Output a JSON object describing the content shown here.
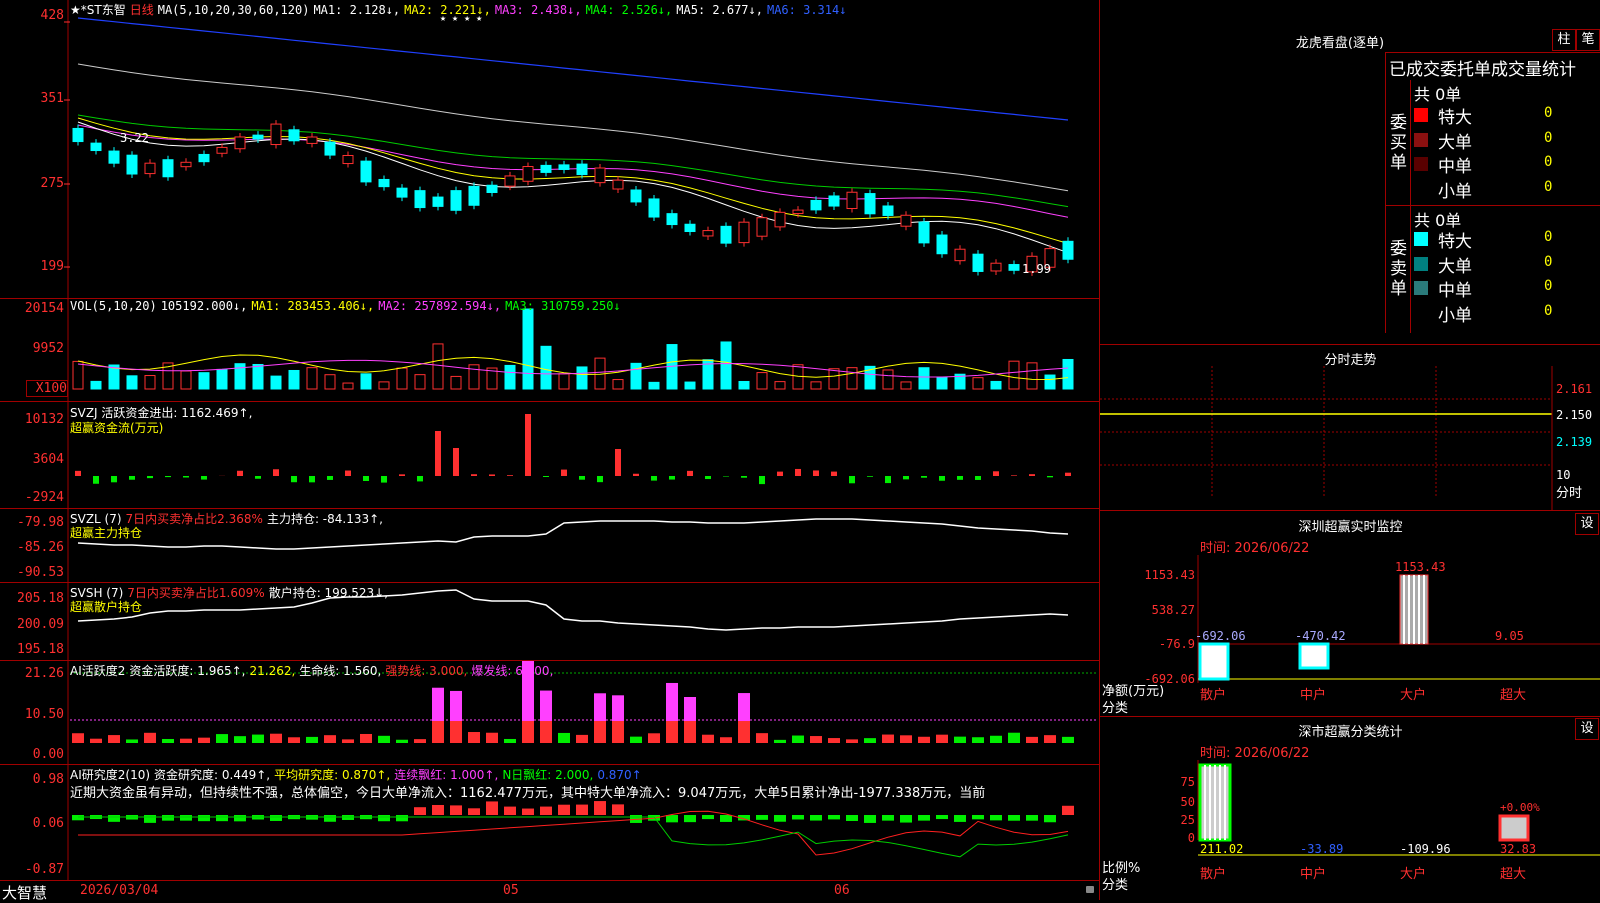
{
  "colors": {
    "up": "#ff3030",
    "down": "#00ffff",
    "bg": "#000000",
    "frame": "#a00000"
  },
  "kline": {
    "stock": "★*ST东智",
    "period": "日线",
    "ma_label": "MA(5,10,20,30,60,120)",
    "ma1": "MA1: 2.128↓,",
    "ma2": "MA2: 2.221↓,",
    "ma3": "MA3: 2.438↓,",
    "ma4": "MA4: 2.526↓,",
    "ma5": "MA5: 2.677↓,",
    "ma6": "MA6: 3.314↓",
    "y_labels": [
      "428",
      "351",
      "275",
      "199"
    ],
    "high_mark": "3.22",
    "low_mark": "1.99",
    "stars": "★ ★ ★ ★"
  },
  "vol": {
    "header": "VOL(5,10,20)",
    "value": "105192.000↓,",
    "ma1": "MA1: 283453.406↓,",
    "ma2": "MA2: 257892.594↓,",
    "ma3": "MA3: 310759.250↓",
    "y_labels": [
      "20154",
      "9952",
      "X100"
    ]
  },
  "svzj": {
    "header": "SVZJ  活跃资金进出: 1162.469↑,",
    "sub": "超赢资金流(万元)",
    "y_labels": [
      "10132",
      "3604",
      "-2924"
    ]
  },
  "svzl": {
    "header": "SVZL (7)",
    "red_text": "7日内买卖净占比2.368%",
    "tail": "主力持仓: -84.133↑,",
    "sub": "超赢主力持仓",
    "y_labels": [
      "-79.98",
      "-85.26",
      "-90.53"
    ]
  },
  "svsh": {
    "header": "SVSH (7)",
    "red_text": "7日内买卖净占比1.609%",
    "tail": "散户持仓: 199.523↓,",
    "sub": "超赢散户持仓",
    "y_labels": [
      "205.18",
      "200.09",
      "195.18"
    ]
  },
  "ai1": {
    "header": "AI活跃度2",
    "a": "资金活跃度: 1.965↑,",
    "b": "21.262,",
    "c": "生命线: 1.560,",
    "d": "强势线: 3.000,",
    "e": "爆发线: 6.000,",
    "y_labels": [
      "21.26",
      "10.50",
      "0.00"
    ]
  },
  "ai2": {
    "header": "AI研究度2(10)",
    "a": "资金研究度: 0.449↑,",
    "b": "平均研究度: 0.870↑,",
    "c": "连续飘红: 1.000↑,",
    "d": "N日飘红: 2.000,",
    "e": "0.870↑",
    "comment": "近期大资金虽有异动，但持续性不强，总体偏空，今日大单净流入：1162.477万元，其中特大单净流入：9.047万元，大单5日累计净出-1977.338万元，当前",
    "y_labels": [
      "0.98",
      "0.06",
      "-0.87"
    ]
  },
  "bottom": {
    "brand": "大智慧",
    "dates": [
      "2026/03/04",
      "05",
      "06"
    ]
  },
  "right": {
    "lhb_title": "龙虎看盘(逐单)",
    "btn_bar": "柱",
    "btn_pen": "笔",
    "stat_title": "已成交委托单成交量统计",
    "buy_label": "委买单",
    "sell_label": "委卖单",
    "buy_total": "共 0单",
    "sell_total": "共 0单",
    "buy_rows": [
      {
        "label": "特大",
        "value": "0",
        "color": "#ff0000"
      },
      {
        "label": "大单",
        "value": "0",
        "color": "#8b1010"
      },
      {
        "label": "中单",
        "value": "0",
        "color": "#5a0000"
      },
      {
        "label": "小单",
        "value": "0",
        "color": ""
      }
    ],
    "sell_rows": [
      {
        "label": "特大",
        "value": "0",
        "color": "#00ffff"
      },
      {
        "label": "大单",
        "value": "0",
        "color": "#008080"
      },
      {
        "label": "中单",
        "value": "0",
        "color": "#2a7a7a"
      },
      {
        "label": "小单",
        "value": "0",
        "color": ""
      }
    ],
    "fenshi_title": "分时走势",
    "fenshi_y": [
      "2.161",
      "2.150",
      "2.139"
    ],
    "fenshi_vol": "10",
    "fenshi_unit": "分时",
    "sz_monitor_title": "深圳超赢实时监控",
    "sz_btn": "设",
    "sz_time": "时间: 2026/06/22",
    "sz_y": [
      "1153.43",
      "538.27",
      "-76.9",
      "-692.06"
    ],
    "sz_bars": [
      {
        "label": "散户",
        "value": "-692.06"
      },
      {
        "label": "中户",
        "value": "-470.42"
      },
      {
        "label": "大户",
        "value": "1153.43"
      },
      {
        "label": "超大",
        "value": "9.05"
      }
    ],
    "sz_net": "净额(万元)",
    "sz_cat": "分类",
    "sc_title": "深市超赢分类统计",
    "sc_btn": "设",
    "sc_time": "时间: 2026/06/22",
    "sc_y": [
      "75",
      "50",
      "25",
      "0"
    ],
    "sc_bars": [
      {
        "label": "散户",
        "value": "211.02"
      },
      {
        "label": "中户",
        "value": "-33.89"
      },
      {
        "label": "大户",
        "value": "-109.96"
      },
      {
        "label": "超大",
        "value": "32.83"
      }
    ],
    "sc_pct": "+0.00%",
    "sc_ratio": "比例%",
    "sc_cat": "分类"
  }
}
